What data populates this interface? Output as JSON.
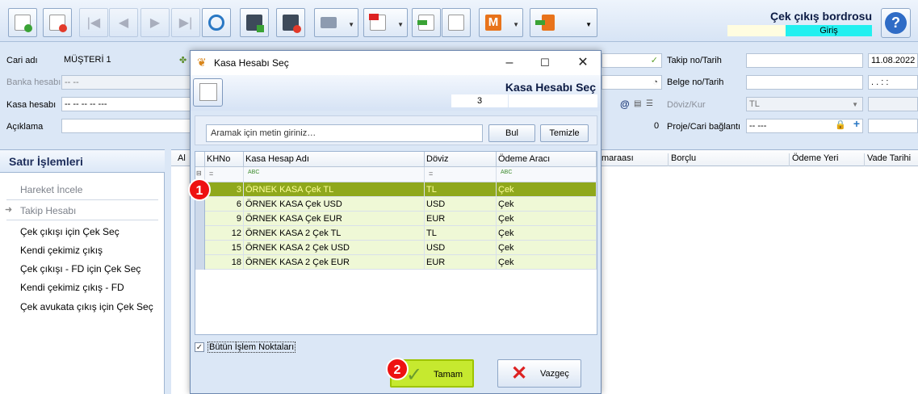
{
  "header": {
    "title": "Çek çıkış bordrosu",
    "mode": "Giriş"
  },
  "form": {
    "cari_label": "Cari adı",
    "cari_value": "MÜŞTERİ 1",
    "banka_label": "Banka hesabı",
    "banka_value": "-- --",
    "kasa_label": "Kasa hesabı",
    "kasa_value": "-- -- -- -- ---",
    "aciklama_label": "Açıklama",
    "takip_label": "Takip no/Tarih",
    "takip_date": "11.08.2022",
    "belge_label": "Belge no/Tarih",
    "belge_date": ".   .     :  :",
    "doviz_label": "Döviz/Kur",
    "doviz_value": "TL",
    "proje_label": "Proje/Cari bağlantı",
    "proje_value": "-- ---",
    "zero_value": "0"
  },
  "left_panel": {
    "title": "Satır İşlemleri",
    "items": [
      "Hareket İncele",
      "Takip Hesabı",
      "Çek çıkışı için Çek Seç",
      "Kendi çekimiz çıkış",
      "Çek çıkışı - FD için Çek Seç",
      "Kendi çekimiz çıkış - FD",
      "Çek avukata çıkış için Çek Seç"
    ]
  },
  "grid": {
    "headers": [
      "Al",
      "maraası",
      "Borçlu",
      "Ödeme Yeri",
      "Vade Tarihi"
    ]
  },
  "dialog": {
    "title": "Kasa Hesabı Seç",
    "header_title": "Kasa Hesabı Seç",
    "count": "3",
    "search_placeholder": "Aramak için metin giriniz…",
    "find_label": "Bul",
    "clear_label": "Temizle",
    "columns": [
      "KHNo",
      "Kasa Hesap Adı",
      "Döviz",
      "Ödeme Aracı"
    ],
    "filter_symbols": [
      "=",
      "ABC",
      "=",
      "ABC"
    ],
    "rows": [
      {
        "no": "3",
        "name": "ÖRNEK KASA Çek TL",
        "currency": "TL",
        "method": "Çek"
      },
      {
        "no": "6",
        "name": "ÖRNEK KASA Çek USD",
        "currency": "USD",
        "method": "Çek"
      },
      {
        "no": "9",
        "name": "ÖRNEK KASA Çek EUR",
        "currency": "EUR",
        "method": "Çek"
      },
      {
        "no": "12",
        "name": "ÖRNEK KASA 2 Çek TL",
        "currency": "TL",
        "method": "Çek"
      },
      {
        "no": "15",
        "name": "ÖRNEK KASA 2 Çek USD",
        "currency": "USD",
        "method": "Çek"
      },
      {
        "no": "18",
        "name": "ÖRNEK KASA 2 Çek EUR",
        "currency": "EUR",
        "method": "Çek"
      }
    ],
    "checkbox_label": "Bütün İşlem Noktaları",
    "ok_label": "Tamam",
    "cancel_label": "Vazgeç"
  },
  "annotations": {
    "step1": "1",
    "step2": "2"
  },
  "colors": {
    "selected_row": "#8fa81c",
    "mode_badge": "#22f0f0",
    "ok_button": "#c6e92f",
    "step_badge": "#e11111"
  }
}
